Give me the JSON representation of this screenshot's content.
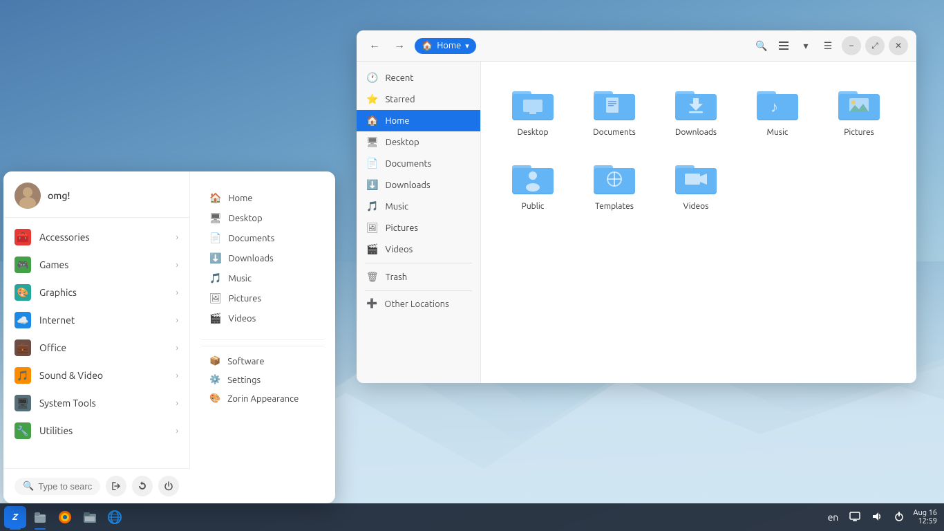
{
  "desktop": {
    "background": "mountain"
  },
  "taskbar": {
    "apps": [
      {
        "name": "zorin-menu",
        "label": "Z",
        "active": true
      },
      {
        "name": "files",
        "label": "🗂",
        "active": true
      },
      {
        "name": "firefox",
        "label": "🦊",
        "active": false
      },
      {
        "name": "nautilus",
        "label": "📁",
        "active": false
      },
      {
        "name": "browser",
        "label": "🌐",
        "active": false
      }
    ],
    "tray": {
      "lang": "en",
      "date": "Aug 16",
      "time": "12:59"
    }
  },
  "start_menu": {
    "user": {
      "name": "omg!",
      "avatar": "👤"
    },
    "categories": [
      {
        "id": "accessories",
        "label": "Accessories",
        "icon": "🧰",
        "color": "#e53935"
      },
      {
        "id": "games",
        "label": "Games",
        "icon": "🎮",
        "color": "#43a047"
      },
      {
        "id": "graphics",
        "label": "Graphics",
        "icon": "🎨",
        "color": "#26a69a"
      },
      {
        "id": "internet",
        "label": "Internet",
        "icon": "☁️",
        "color": "#1e88e5"
      },
      {
        "id": "office",
        "label": "Office",
        "icon": "💼",
        "color": "#6d4c41"
      },
      {
        "id": "sound-video",
        "label": "Sound & Video",
        "icon": "🎵",
        "color": "#fb8c00"
      },
      {
        "id": "system-tools",
        "label": "System Tools",
        "icon": "🖥",
        "color": "#546e7a"
      },
      {
        "id": "utilities",
        "label": "Utilities",
        "icon": "🔧",
        "color": "#43a047"
      }
    ],
    "places": [
      {
        "id": "home",
        "label": "Home",
        "icon": "🏠"
      },
      {
        "id": "desktop",
        "label": "Desktop",
        "icon": "🖥"
      },
      {
        "id": "documents",
        "label": "Documents",
        "icon": "📄"
      },
      {
        "id": "downloads",
        "label": "Downloads",
        "icon": "⬇️"
      },
      {
        "id": "music",
        "label": "Music",
        "icon": "🎵"
      },
      {
        "id": "pictures",
        "label": "Pictures",
        "icon": "🖼"
      },
      {
        "id": "videos",
        "label": "Videos",
        "icon": "🎬"
      }
    ],
    "system": [
      {
        "id": "software",
        "label": "Software",
        "icon": "📦"
      },
      {
        "id": "settings",
        "label": "Settings",
        "icon": "⚙️"
      },
      {
        "id": "zorin-appearance",
        "label": "Zorin Appearance",
        "icon": "🎨"
      }
    ],
    "footer": {
      "search_placeholder": "Type to search...",
      "logout_label": "Log Out",
      "refresh_label": "Refresh",
      "power_label": "Power"
    }
  },
  "file_manager": {
    "title": "Home",
    "sidebar": [
      {
        "id": "recent",
        "label": "Recent",
        "icon": "🕐",
        "active": false
      },
      {
        "id": "starred",
        "label": "Starred",
        "icon": "⭐",
        "active": false
      },
      {
        "id": "home",
        "label": "Home",
        "icon": "🏠",
        "active": true
      },
      {
        "id": "desktop",
        "label": "Desktop",
        "icon": "🖥",
        "active": false
      },
      {
        "id": "documents",
        "label": "Documents",
        "icon": "📄",
        "active": false
      },
      {
        "id": "downloads",
        "label": "Downloads",
        "icon": "⬇️",
        "active": false
      },
      {
        "id": "music",
        "label": "Music",
        "icon": "🎵",
        "active": false
      },
      {
        "id": "pictures",
        "label": "Pictures",
        "icon": "🖼",
        "active": false
      },
      {
        "id": "videos",
        "label": "Videos",
        "icon": "🎬",
        "active": false
      },
      {
        "id": "trash",
        "label": "Trash",
        "icon": "🗑",
        "active": false
      },
      {
        "id": "other-locations",
        "label": "Other Locations",
        "icon": "➕",
        "active": false
      }
    ],
    "folders": [
      {
        "id": "desktop",
        "label": "Desktop",
        "type": "basic"
      },
      {
        "id": "documents",
        "label": "Documents",
        "type": "doc"
      },
      {
        "id": "downloads",
        "label": "Downloads",
        "type": "download"
      },
      {
        "id": "music",
        "label": "Music",
        "type": "music"
      },
      {
        "id": "pictures",
        "label": "Pictures",
        "type": "pictures"
      },
      {
        "id": "public",
        "label": "Public",
        "type": "public"
      },
      {
        "id": "templates",
        "label": "Templates",
        "type": "templates"
      },
      {
        "id": "videos",
        "label": "Videos",
        "type": "videos"
      }
    ],
    "toolbar": {
      "back": "←",
      "forward": "→",
      "search": "🔍",
      "view_list": "≡",
      "view_toggle": "▾",
      "more": "☰",
      "minimize": "−",
      "maximize": "⤢",
      "close": "✕",
      "location_dropdown": "▾"
    }
  }
}
